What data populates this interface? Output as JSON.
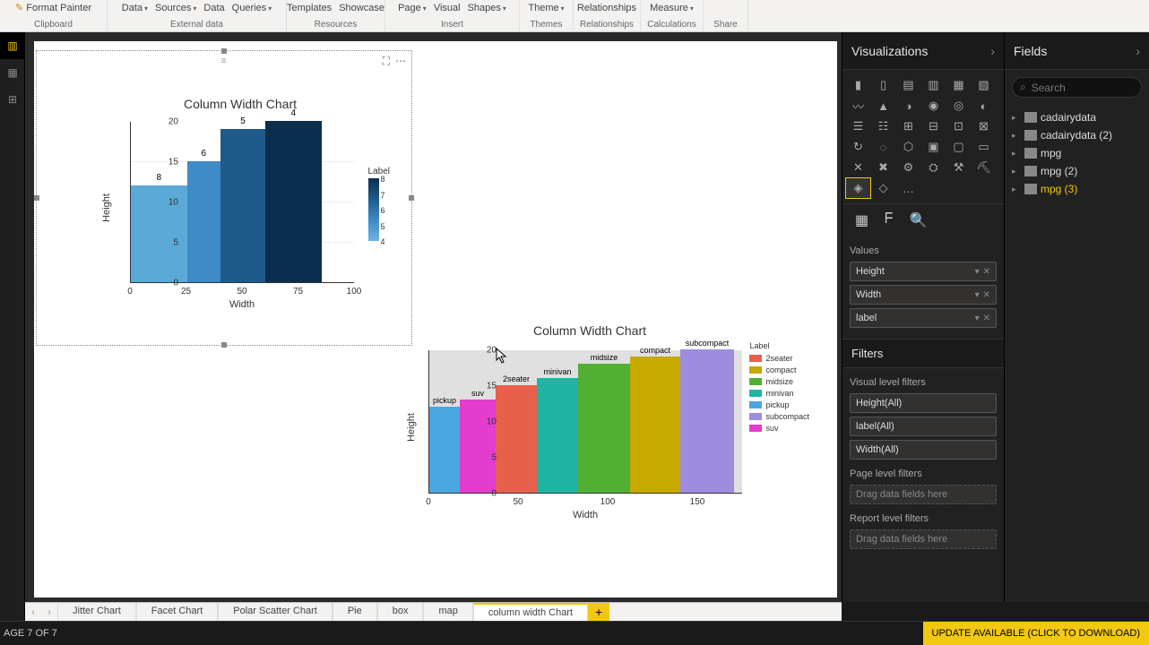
{
  "ribbon": {
    "clipboard": {
      "format_painter": "Format Painter",
      "label": "Clipboard"
    },
    "external": {
      "data1": "Data",
      "sources": "Sources",
      "data2": "Data",
      "queries": "Queries",
      "label": "External data"
    },
    "resources": {
      "templates": "Templates",
      "showcase": "Showcase",
      "label": "Resources"
    },
    "insert": {
      "page": "Page",
      "visual": "Visual",
      "shapes": "Shapes",
      "label": "Insert"
    },
    "themes": {
      "theme": "Theme",
      "label": "Themes"
    },
    "relationships": {
      "relationships": "Relationships",
      "label": "Relationships"
    },
    "calculations": {
      "measure": "Measure",
      "label": "Calculations"
    },
    "share": {
      "label": "Share"
    }
  },
  "viz_panel": {
    "title": "Visualizations"
  },
  "fields_panel": {
    "title": "Fields",
    "search_placeholder": "Search",
    "tables": [
      "cadairydata",
      "cadairydata (2)",
      "mpg",
      "mpg (2)",
      "mpg (3)"
    ]
  },
  "values": {
    "title": "Values",
    "items": [
      "Height",
      "Width",
      "label"
    ]
  },
  "filters": {
    "title": "Filters",
    "visual_title": "Visual level filters",
    "visual_items": [
      "Height(All)",
      "label(All)",
      "Width(All)"
    ],
    "page_title": "Page level filters",
    "page_placeholder": "Drag data fields here",
    "report_title": "Report level filters",
    "report_placeholder": "Drag data fields here"
  },
  "page_tabs": [
    "Jitter Chart",
    "Facet Chart",
    "Polar Scatter Chart",
    "Pie",
    "box",
    "map",
    "column width Chart"
  ],
  "status": {
    "page": "AGE 7 OF 7",
    "update": "UPDATE AVAILABLE (CLICK TO DOWNLOAD)"
  },
  "chart_data": [
    {
      "type": "bar",
      "title": "Column Width Chart",
      "xlabel": "Width",
      "ylabel": "Height",
      "legend_title": "Label",
      "xlim": [
        0,
        100
      ],
      "ylim": [
        0,
        20
      ],
      "xticks": [
        0,
        25,
        50,
        75,
        100
      ],
      "yticks": [
        0,
        5,
        10,
        15,
        20
      ],
      "legend_ticks": [
        8,
        7,
        6,
        5,
        4
      ],
      "bars": [
        {
          "x_start": 0,
          "x_end": 25,
          "height": 12,
          "label": "8",
          "color": "#5aa9d6"
        },
        {
          "x_start": 25,
          "x_end": 40,
          "height": 15,
          "label": "6",
          "color": "#3d8bc7"
        },
        {
          "x_start": 40,
          "x_end": 60,
          "height": 19,
          "label": "5",
          "color": "#1f5a8a"
        },
        {
          "x_start": 60,
          "x_end": 85,
          "height": 20,
          "label": "4",
          "color": "#0b2e4f"
        }
      ]
    },
    {
      "type": "bar",
      "title": "Column Width Chart",
      "xlabel": "Width",
      "ylabel": "Height",
      "legend_title": "Label",
      "xlim": [
        0,
        175
      ],
      "ylim": [
        0,
        20
      ],
      "xticks": [
        0,
        50,
        100,
        150
      ],
      "yticks": [
        0,
        5,
        10,
        15,
        20
      ],
      "bars": [
        {
          "category": "pickup",
          "x_start": 0,
          "x_end": 17,
          "height": 12,
          "color": "#4aa6e0"
        },
        {
          "category": "suv",
          "x_start": 17,
          "x_end": 37,
          "height": 13,
          "color": "#e33ccf"
        },
        {
          "category": "2seater",
          "x_start": 37,
          "x_end": 60,
          "height": 15,
          "color": "#e8604c"
        },
        {
          "category": "minivan",
          "x_start": 60,
          "x_end": 83,
          "height": 16,
          "color": "#1fb5a3"
        },
        {
          "category": "midsize",
          "x_start": 83,
          "x_end": 112,
          "height": 18,
          "color": "#51b033"
        },
        {
          "category": "compact",
          "x_start": 112,
          "x_end": 140,
          "height": 19,
          "color": "#c7a900"
        },
        {
          "category": "subcompact",
          "x_start": 140,
          "x_end": 170,
          "height": 20,
          "color": "#9d8ce0"
        }
      ],
      "legend": [
        {
          "name": "2seater",
          "color": "#e8604c"
        },
        {
          "name": "compact",
          "color": "#c7a900"
        },
        {
          "name": "midsize",
          "color": "#51b033"
        },
        {
          "name": "minivan",
          "color": "#1fb5a3"
        },
        {
          "name": "pickup",
          "color": "#4aa6e0"
        },
        {
          "name": "subcompact",
          "color": "#9d8ce0"
        },
        {
          "name": "suv",
          "color": "#e33ccf"
        }
      ]
    }
  ]
}
